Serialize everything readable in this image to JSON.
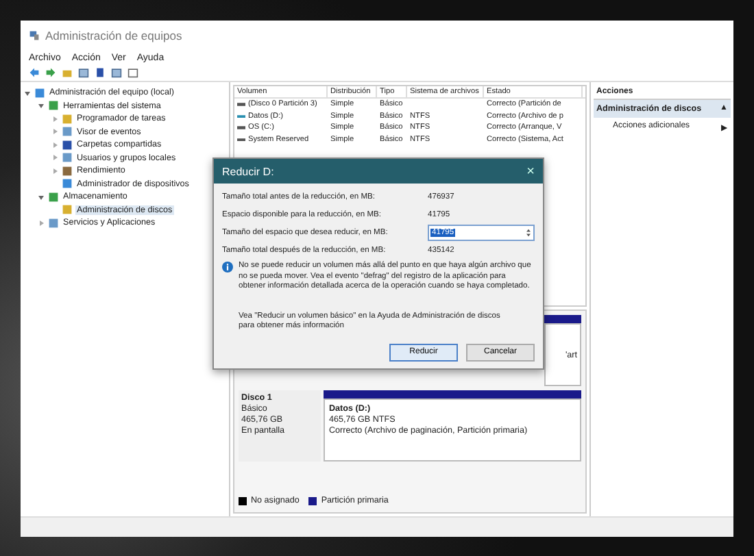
{
  "window": {
    "title": "Administración de equipos"
  },
  "menu": [
    "Archivo",
    "Acción",
    "Ver",
    "Ayuda"
  ],
  "tree": [
    {
      "label": "Administración del equipo (local)",
      "expanded": true,
      "children": [
        {
          "label": "Herramientas del sistema",
          "expanded": true,
          "children": [
            {
              "label": "Programador de tareas",
              "expanded": false
            },
            {
              "label": "Visor de eventos",
              "expanded": false
            },
            {
              "label": "Carpetas compartidas",
              "expanded": false
            },
            {
              "label": "Usuarios y grupos locales",
              "expanded": false
            },
            {
              "label": "Rendimiento",
              "expanded": false
            },
            {
              "label": "Administrador de dispositivos"
            }
          ]
        },
        {
          "label": "Almacenamiento",
          "expanded": true,
          "children": [
            {
              "label": "Administración de discos",
              "selected": true
            }
          ]
        },
        {
          "label": "Servicios y Aplicaciones",
          "expanded": false
        }
      ]
    }
  ],
  "table": {
    "columns": [
      "Volumen",
      "Distribución",
      "Tipo",
      "Sistema de archivos",
      "Estado"
    ],
    "rows": [
      {
        "color": "#555555",
        "cells": [
          "(Disco 0 Partición 3)",
          "Simple",
          "Básico",
          "",
          "Correcto (Partición de"
        ]
      },
      {
        "color": "#2a8fb0",
        "cells": [
          "Datos (D:)",
          "Simple",
          "Básico",
          "NTFS",
          "Correcto (Archivo de p"
        ]
      },
      {
        "color": "#555555",
        "cells": [
          "OS (C:)",
          "Simple",
          "Básico",
          "NTFS",
          "Correcto (Arranque, V"
        ]
      },
      {
        "color": "#555555",
        "cells": [
          "System Reserved",
          "Simple",
          "Básico",
          "NTFS",
          "Correcto (Sistema, Act"
        ]
      }
    ]
  },
  "disk0": {
    "partition_fragment": "'art"
  },
  "disk1": {
    "name": "Disco 1",
    "type": "Básico",
    "size": "465,76 GB",
    "status": "En pantalla",
    "partition": {
      "title": "Datos  (D:)",
      "size": "465,76 GB NTFS",
      "status": "Correcto (Archivo de paginación, Partición primaria)"
    }
  },
  "legend": [
    {
      "label": "No asignado",
      "color": "#000000"
    },
    {
      "label": "Partición primaria",
      "color": "#1a1a8a"
    }
  ],
  "actions": {
    "header": "Acciones",
    "section": {
      "label": "Administración de discos",
      "arrow": "▲"
    },
    "items": [
      {
        "label": "Acciones adicionales",
        "arrow": "▶"
      }
    ]
  },
  "dialog": {
    "title": "Reducir D:",
    "close": "×",
    "fields": [
      {
        "kind": "text",
        "label": "Tamaño total antes de la reducción, en MB:",
        "value": "476937"
      },
      {
        "kind": "text",
        "label": "Espacio disponible para la reducción, en MB:",
        "value": "41795"
      },
      {
        "kind": "spin",
        "label": "Tamaño del espacio que desea reducir, en MB:",
        "value": "41795"
      },
      {
        "kind": "text",
        "label": "Tamaño total después de la reducción, en MB:",
        "value": "435142"
      }
    ],
    "info": "No se puede reducir un volumen más allá del punto en que haya algún archivo que no se pueda mover. Vea el evento \"defrag\" del registro de la aplicación para obtener información detallada acerca de la operación cuando se haya completado.",
    "help": "Vea \"Reducir un volumen básico\"  en la Ayuda de Administración de discos para obtener más información",
    "buttons": [
      {
        "label": "Reducir",
        "selected": true
      },
      {
        "label": "Cancelar",
        "selected": false
      }
    ]
  }
}
